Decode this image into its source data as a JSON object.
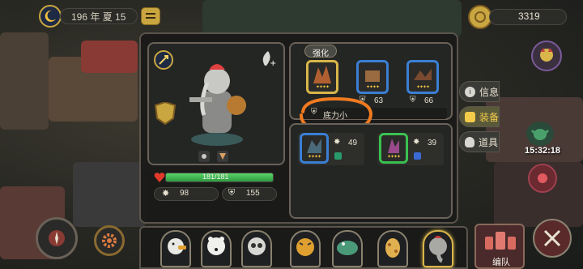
{
  "top_bar": {
    "date_text": "196 年 夏 15",
    "gold_value": "3319"
  },
  "equipment": {
    "tab_label": "强化",
    "slots_row1": [
      {
        "value": "",
        "frame_color": "#d9b64a"
      },
      {
        "value": "63",
        "frame_color": "#3a7fd4"
      },
      {
        "value": "66",
        "frame_color": "#3a7fd4"
      }
    ],
    "slot_name": "底力小",
    "slots_row2": [
      {
        "value": "49",
        "frame_color": "#3a7fd4"
      },
      {
        "value": "39",
        "frame_color": "#3ac050"
      }
    ]
  },
  "hero": {
    "hp_text": "181/181",
    "hp_fraction": 1.0,
    "attack": "98",
    "defense": "155"
  },
  "side_tabs": [
    {
      "label": "信息",
      "icon": "info-icon",
      "active": false
    },
    {
      "label": "装备",
      "icon": "shield-icon",
      "active": true
    },
    {
      "label": "道具",
      "icon": "potion-icon",
      "active": false
    }
  ],
  "right_hud": {
    "timer": "15:32:18"
  },
  "formation": {
    "label": "编队",
    "heroes": [
      "duck",
      "polar-bear",
      "owl",
      "tiger",
      "crocodile",
      "giraffe",
      "elephant"
    ],
    "active_index": 6
  },
  "colors": {
    "gold": "#d9b64a",
    "hp_green": "#3ac050",
    "hp_heart": "#e23a2a",
    "annotation": "#f07a20"
  }
}
